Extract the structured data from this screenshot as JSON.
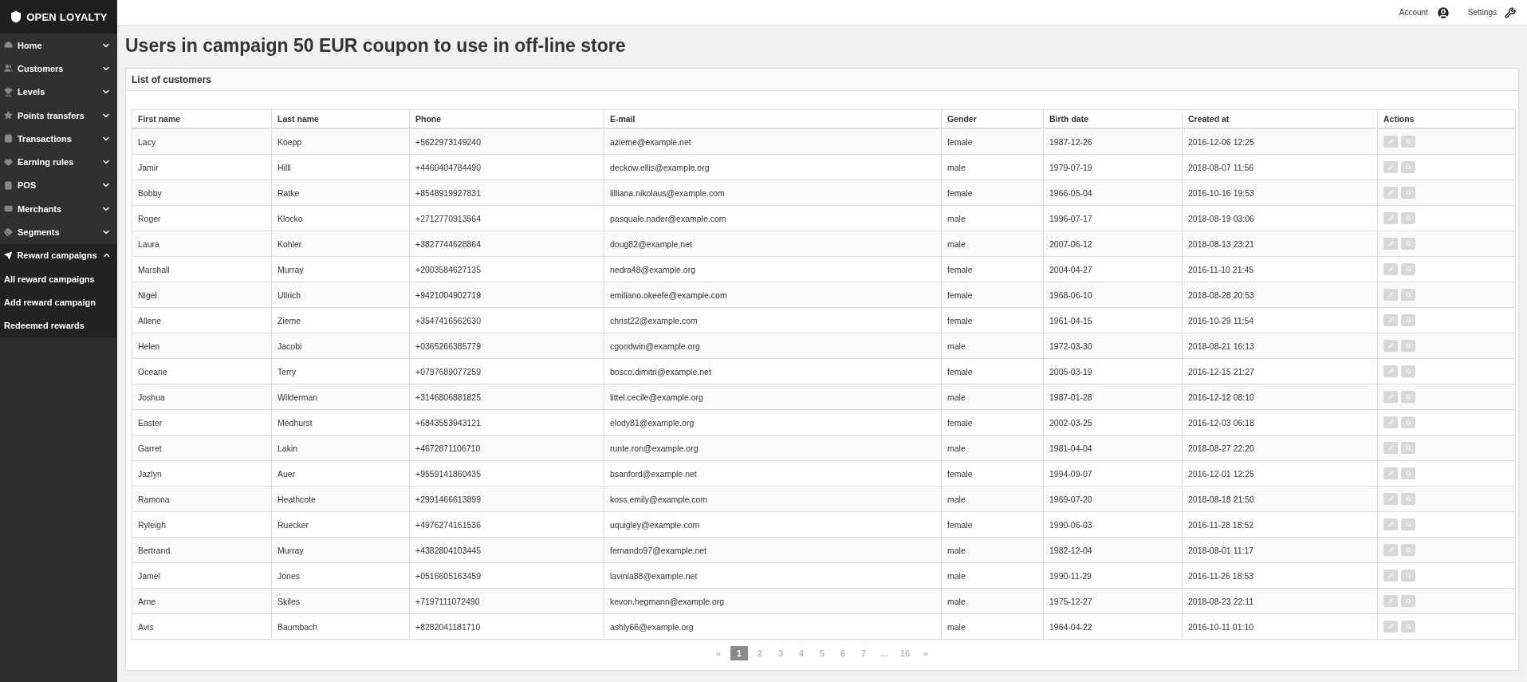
{
  "brand": {
    "name": "OPEN LOYALTY"
  },
  "topbar": {
    "account": "Account",
    "settings": "Settings"
  },
  "sidebar": {
    "items": [
      {
        "label": "Home",
        "expanded": false
      },
      {
        "label": "Customers",
        "expanded": false
      },
      {
        "label": "Levels",
        "expanded": false
      },
      {
        "label": "Points transfers",
        "expanded": false
      },
      {
        "label": "Transactions",
        "expanded": false
      },
      {
        "label": "Earning rules",
        "expanded": false
      },
      {
        "label": "POS",
        "expanded": false
      },
      {
        "label": "Merchants",
        "expanded": false
      },
      {
        "label": "Segments",
        "expanded": false
      },
      {
        "label": "Reward campaigns",
        "expanded": true,
        "children": [
          {
            "label": "All reward campaigns"
          },
          {
            "label": "Add reward campaign"
          },
          {
            "label": "Redeemed rewards"
          }
        ]
      }
    ]
  },
  "page": {
    "title": "Users in campaign 50 EUR coupon to use in off-line store"
  },
  "panel": {
    "title": "List of customers"
  },
  "table": {
    "columns": [
      "First name",
      "Last name",
      "Phone",
      "E-mail",
      "Gender",
      "Birth date",
      "Created at",
      "Actions"
    ],
    "rows": [
      [
        "Lacy",
        "Koepp",
        "+5622973149240",
        "azieme@example.net",
        "female",
        "1987-12-26",
        "2016-12-06 12:25"
      ],
      [
        "Jamir",
        "Hilll",
        "+4460404784490",
        "deckow.ellis@example.org",
        "male",
        "1979-07-19",
        "2018-08-07 11:56"
      ],
      [
        "Bobby",
        "Ratke",
        "+8548919927831",
        "lilliana.nikolaus@example.com",
        "female",
        "1966-05-04",
        "2016-10-16 19:53"
      ],
      [
        "Roger",
        "Klocko",
        "+2712770913564",
        "pasquale.nader@example.com",
        "male",
        "1996-07-17",
        "2018-08-19 03:06"
      ],
      [
        "Laura",
        "Kohler",
        "+3827744628864",
        "doug82@example.net",
        "male",
        "2007-06-12",
        "2018-08-13 23:21"
      ],
      [
        "Marshall",
        "Murray",
        "+2003584627135",
        "nedra48@example.org",
        "female",
        "2004-04-27",
        "2016-11-10 21:45"
      ],
      [
        "Nigel",
        "Ullrich",
        "+9421004902719",
        "emiliano.okeefe@example.com",
        "female",
        "1968-06-10",
        "2018-08-28 20:53"
      ],
      [
        "Allene",
        "Zieme",
        "+3547416562630",
        "christ22@example.com",
        "female",
        "1961-04-15",
        "2016-10-29 11:54"
      ],
      [
        "Helen",
        "Jacobi",
        "+0365266385779",
        "cgoodwin@example.org",
        "male",
        "1972-03-30",
        "2018-08-21 16:13"
      ],
      [
        "Oceane",
        "Terry",
        "+0797689077259",
        "bosco.dimitri@example.net",
        "female",
        "2005-03-19",
        "2016-12-15 21:27"
      ],
      [
        "Joshua",
        "Wilderman",
        "+3146806881825",
        "littel.cecile@example.org",
        "male",
        "1987-01-28",
        "2016-12-12 08:10"
      ],
      [
        "Easter",
        "Medhurst",
        "+6843553943121",
        "elody81@example.org",
        "female",
        "2002-03-25",
        "2016-12-03 06:18"
      ],
      [
        "Garret",
        "Lakin",
        "+4672871106710",
        "runte.ron@example.org",
        "male",
        "1981-04-04",
        "2018-08-27 22:20"
      ],
      [
        "Jazlyn",
        "Auer",
        "+9559141860435",
        "bsanford@example.net",
        "female",
        "1994-09-07",
        "2016-12-01 12:25"
      ],
      [
        "Ramona",
        "Heathcote",
        "+2991466613899",
        "koss.emily@example.com",
        "male",
        "1969-07-20",
        "2018-08-18 21:50"
      ],
      [
        "Ryleigh",
        "Ruecker",
        "+4976274161536",
        "uquigley@example.com",
        "female",
        "1990-06-03",
        "2016-11-28 18:52"
      ],
      [
        "Bertrand",
        "Murray",
        "+4382804103445",
        "fernando97@example.net",
        "male",
        "1982-12-04",
        "2018-08-01 11:17"
      ],
      [
        "Jamel",
        "Jones",
        "+0516605163459",
        "lavinia88@example.net",
        "male",
        "1990-11-29",
        "2016-11-26 18:53"
      ],
      [
        "Arne",
        "Skiles",
        "+7197111072490",
        "kevon.hegmann@example.org",
        "male",
        "1975-12-27",
        "2018-08-23 22:11"
      ],
      [
        "Avis",
        "Baumbach",
        "+8282041181710",
        "ashly66@example.org",
        "male",
        "1964-04-22",
        "2016-10-11 01:10"
      ]
    ]
  },
  "pagination": {
    "prev": "«",
    "next": "»",
    "pages": [
      {
        "label": "1",
        "selected": true
      },
      {
        "label": "2",
        "selected": false
      },
      {
        "label": "3",
        "selected": false
      },
      {
        "label": "4",
        "selected": false
      },
      {
        "label": "5",
        "selected": false
      },
      {
        "label": "6",
        "selected": false
      },
      {
        "label": "7",
        "selected": false
      },
      {
        "label": "...",
        "selected": false
      },
      {
        "label": "16",
        "selected": false
      }
    ]
  }
}
